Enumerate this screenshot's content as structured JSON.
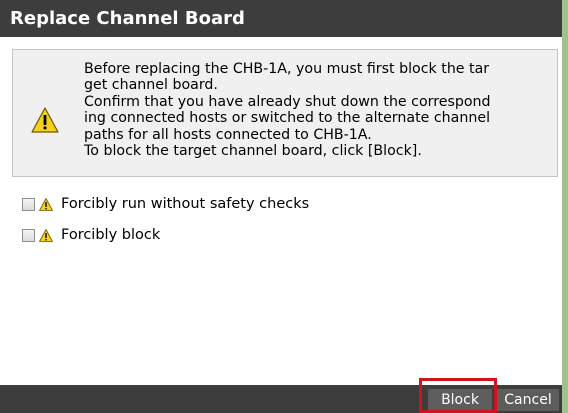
{
  "dialog": {
    "title": "Replace Channel Board"
  },
  "message": {
    "icon": "warning-icon",
    "lines": [
      "Before replacing the CHB-1A, you must first block the tar",
      "get channel board.",
      "Confirm that you have already shut down the correspond",
      "ing connected hosts or switched to the alternate channel",
      "paths for all hosts connected to CHB-1A.",
      "To block the target channel board, click [Block]."
    ]
  },
  "options": [
    {
      "label": "Forcibly run without safety checks",
      "checked": false,
      "icon": "warning-icon"
    },
    {
      "label": "Forcibly block",
      "checked": false,
      "icon": "warning-icon"
    }
  ],
  "footer": {
    "block_label": "Block",
    "cancel_label": "Cancel"
  },
  "colors": {
    "title_bar": "#3d3d3d",
    "footer_bar": "#3d3d3d",
    "button": "#5d5d5d",
    "highlight": "#d0121a",
    "message_bg": "#f0f0f0"
  }
}
